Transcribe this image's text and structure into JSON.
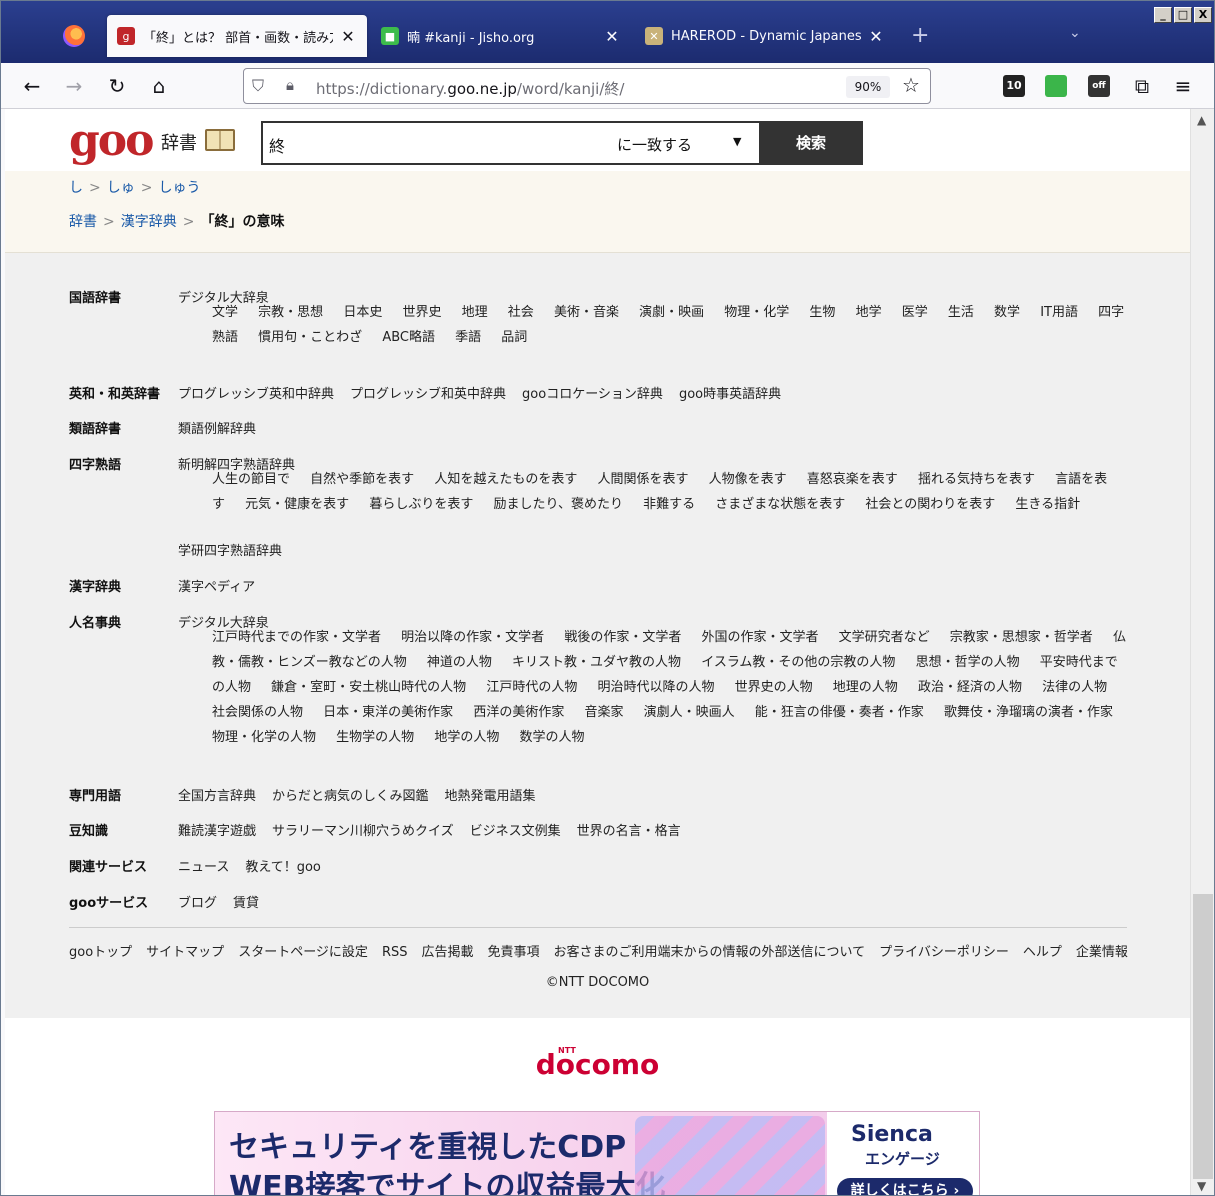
{
  "browser": {
    "tabs": [
      {
        "title": "「終」とは？ 部首・画数・読み方",
        "favicon_color": "#c0262a",
        "favicon_glyph": "g",
        "active": true
      },
      {
        "title": "暔 #kanji - Jisho.org",
        "favicon_color": "#3dbc4c",
        "favicon_glyph": "■",
        "active": false
      },
      {
        "title": "HAREROD - Dynamic Japanese Rea",
        "favicon_color": "#c9b27a",
        "favicon_glyph": "✕",
        "active": false
      }
    ],
    "new_tab_glyph": "+",
    "tab_list_glyph": "⌄",
    "window_buttons": [
      "_",
      "□",
      "X"
    ],
    "url_scheme": "https://dictionary.",
    "url_host": "goo.ne.jp",
    "url_path": "/word/kanji/終/",
    "zoom": "90%",
    "extensions": [
      {
        "name": "10-ext-icon",
        "label": "10",
        "color": "#222"
      },
      {
        "name": "green-ext-icon",
        "label": "",
        "color": "#3bb54a"
      },
      {
        "name": "off-ext-icon",
        "label": "off",
        "color": "#333"
      }
    ]
  },
  "header": {
    "logo": "goo",
    "logo_sub": "辞書",
    "search_value": "終",
    "search_mode": "に一致する",
    "search_button": "検索"
  },
  "breadcrumb": {
    "readings": [
      "し",
      "しゅ",
      "しゅう"
    ],
    "path": [
      "辞書",
      "漢字辞典"
    ],
    "current": "「終」の意味"
  },
  "catalog": [
    {
      "label": "国語辞書",
      "main": [
        "デジタル大辞泉"
      ],
      "sub": [
        "文学",
        "宗教・思想",
        "日本史",
        "世界史",
        "地理",
        "社会",
        "美術・音楽",
        "演劇・映画",
        "物理・化学",
        "生物",
        "地学",
        "医学",
        "生活",
        "数学",
        "IT用語",
        "四字熟語",
        "慣用句・ことわざ",
        "ABC略語",
        "季語",
        "品詞"
      ]
    },
    {
      "label": "英和・和英辞書",
      "main": [
        "プログレッシブ英和中辞典",
        "プログレッシブ和英中辞典",
        "gooコロケーション辞典",
        "goo時事英語辞典"
      ],
      "sub": []
    },
    {
      "label": "類語辞書",
      "main": [
        "類語例解辞典"
      ],
      "sub": []
    },
    {
      "label": "四字熟語",
      "main": [
        "新明解四字熟語辞典"
      ],
      "sub": [
        "人生の節目で",
        "自然や季節を表す",
        "人知を越えたものを表す",
        "人間関係を表す",
        "人物像を表す",
        "喜怒哀楽を表す",
        "揺れる気持ちを表す",
        "言語を表す",
        "元気・健康を表す",
        "暮らしぶりを表す",
        "励ましたり、褒めたり",
        "非難する",
        "さまざまな状態を表す",
        "社会との関わりを表す",
        "生きる指針"
      ],
      "extra": "学研四字熟語辞典"
    },
    {
      "label": "漢字辞典",
      "main": [
        "漢字ペディア"
      ],
      "sub": []
    },
    {
      "label": "人名事典",
      "main": [
        "デジタル大辞泉"
      ],
      "sub": [
        "江戸時代までの作家・文学者",
        "明治以降の作家・文学者",
        "戦後の作家・文学者",
        "外国の作家・文学者",
        "文学研究者など",
        "宗教家・思想家・哲学者",
        "仏教・儒教・ヒンズー教などの人物",
        "神道の人物",
        "キリスト教・ユダヤ教の人物",
        "イスラム教・その他の宗教の人物",
        "思想・哲学の人物",
        "平安時代までの人物",
        "鎌倉・室町・安土桃山時代の人物",
        "江戸時代の人物",
        "明治時代以降の人物",
        "世界史の人物",
        "地理の人物",
        "政治・経済の人物",
        "法律の人物",
        "社会関係の人物",
        "日本・東洋の美術作家",
        "西洋の美術作家",
        "音楽家",
        "演劇人・映画人",
        "能・狂言の俳優・奏者・作家",
        "歌舞伎・浄瑠璃の演者・作家",
        "物理・化学の人物",
        "生物学の人物",
        "地学の人物",
        "数学の人物"
      ]
    },
    {
      "label": "専門用語",
      "main": [
        "全国方言辞典",
        "からだと病気のしくみ図鑑",
        "地熱発電用語集"
      ],
      "sub": []
    },
    {
      "label": "豆知識",
      "main": [
        "難読漢字遊戯",
        "サラリーマン川柳穴うめクイズ",
        "ビジネス文例集",
        "世界の名言・格言"
      ],
      "sub": []
    },
    {
      "label": "関連サービス",
      "main": [
        "ニュース",
        "教えて！goo"
      ],
      "sub": []
    },
    {
      "label": "gooサービス",
      "main": [
        "ブログ",
        "賃貸"
      ],
      "sub": []
    }
  ],
  "footer": {
    "links": [
      "gooトップ",
      "サイトマップ",
      "スタートページに設定",
      "RSS",
      "広告掲載",
      "免責事項",
      "お客さまのご利用端末からの情報の外部送信について",
      "プライバシーポリシー",
      "ヘルプ",
      "企業情報"
    ],
    "copyright": "©NTT DOCOMO",
    "docomo": "docomo",
    "docomo_ntt": "NTT"
  },
  "ad": {
    "line1": "セキュリティを重視したCDP",
    "line2": "WEB接客でサイトの収益最大化",
    "brand": "Sienca",
    "brand_sub": "エンゲージ",
    "cta": "詳しくはこちら ›"
  }
}
